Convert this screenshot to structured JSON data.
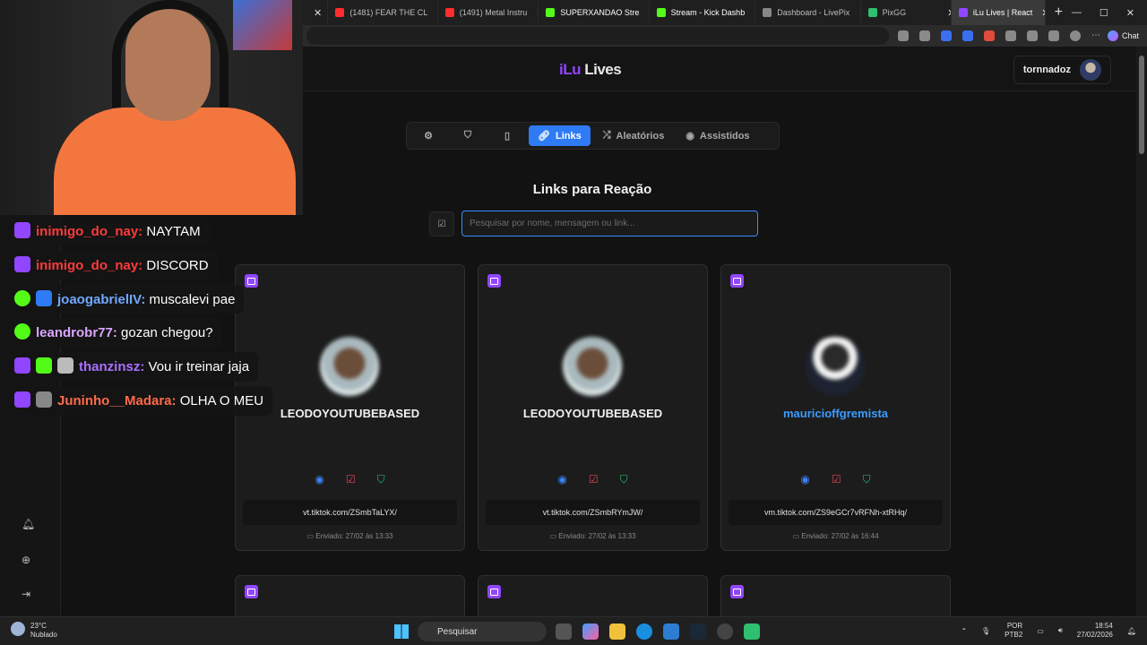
{
  "browser": {
    "tabs": [
      {
        "label": "(1481) FEAR THE CL",
        "color": "#ff2d2d",
        "active": false
      },
      {
        "label": "(1491) Metal Instru",
        "color": "#ff2d2d",
        "active": false
      },
      {
        "label": "SUPERXANDAO Stre",
        "color": "#53fc18",
        "active": false
      },
      {
        "label": "Stream - Kick Dashb",
        "color": "#53fc18",
        "active": false
      },
      {
        "label": "Dashboard - LivePix",
        "color": "#888888",
        "active": false
      },
      {
        "label": "PixGG",
        "color": "#2fbf71",
        "active": false
      },
      {
        "label": "iLu Lives | React",
        "color": "#9146ff",
        "active": true
      }
    ],
    "chat_label": "Chat"
  },
  "header": {
    "logo_a": "iLu",
    "logo_b": "Lives",
    "username": "tornnadoz"
  },
  "nav": {
    "tabs": [
      {
        "icon": "gear-icon",
        "label": ""
      },
      {
        "icon": "shield-icon",
        "label": ""
      },
      {
        "icon": "tablet-icon",
        "label": ""
      },
      {
        "icon": "link-icon",
        "label": "Links",
        "active": true
      },
      {
        "icon": "shuffle-icon",
        "label": "Aleatórios"
      },
      {
        "icon": "eye-icon",
        "label": "Assistidos"
      }
    ]
  },
  "section": {
    "title": "Links para Reação",
    "search_placeholder": "Pesquisar por nome, mensagem ou link..."
  },
  "cards": [
    {
      "name": "LEODOYOUTUBEBASED",
      "link": "vt.tiktok.com/ZSmbTaLYX/",
      "sent": "Enviado: 27/02 às 13:33",
      "name_color": "#f2f2f2"
    },
    {
      "name": "LEODOYOUTUBEBASED",
      "link": "vt.tiktok.com/ZSmbRYmJW/",
      "sent": "Enviado: 27/02 às 13:33",
      "name_color": "#f2f2f2"
    },
    {
      "name": "mauricioffgremista",
      "link": "vm.tiktok.com/ZS9eGCr7vRFNh-xtRHq/",
      "sent": "Enviado: 27/02 às 16:44",
      "name_color": "#3b9cff"
    }
  ],
  "chat": [
    {
      "platform": "twitch",
      "user": "inimigo_do_nay:",
      "color": "#ff3a3a",
      "text": "NAYTAM"
    },
    {
      "platform": "twitch",
      "user": "inimigo_do_nay:",
      "color": "#ff3a3a",
      "text": "DISCORD"
    },
    {
      "platform": "kick",
      "user": "joaogabrielIV:",
      "color": "#6fa8ff",
      "text": "muscalevi pae"
    },
    {
      "platform": "kick",
      "user": "leandrobr77:",
      "color": "#d9a6ff",
      "text": "gozan chegou?"
    },
    {
      "platform": "twitch",
      "user": "thanzinsz:",
      "color": "#a970ff",
      "text": "Vou ir treinar jaja"
    },
    {
      "platform": "twitch",
      "user": "Juninho__Madara:",
      "color": "#ff6a4a",
      "text": "OLHA O MEU"
    }
  ],
  "taskbar": {
    "temp": "23°C",
    "weather": "Nublado",
    "search": "Pesquisar",
    "lang": "POR",
    "layout": "PTB2",
    "time": "18:54",
    "date": "27/02/2026"
  }
}
